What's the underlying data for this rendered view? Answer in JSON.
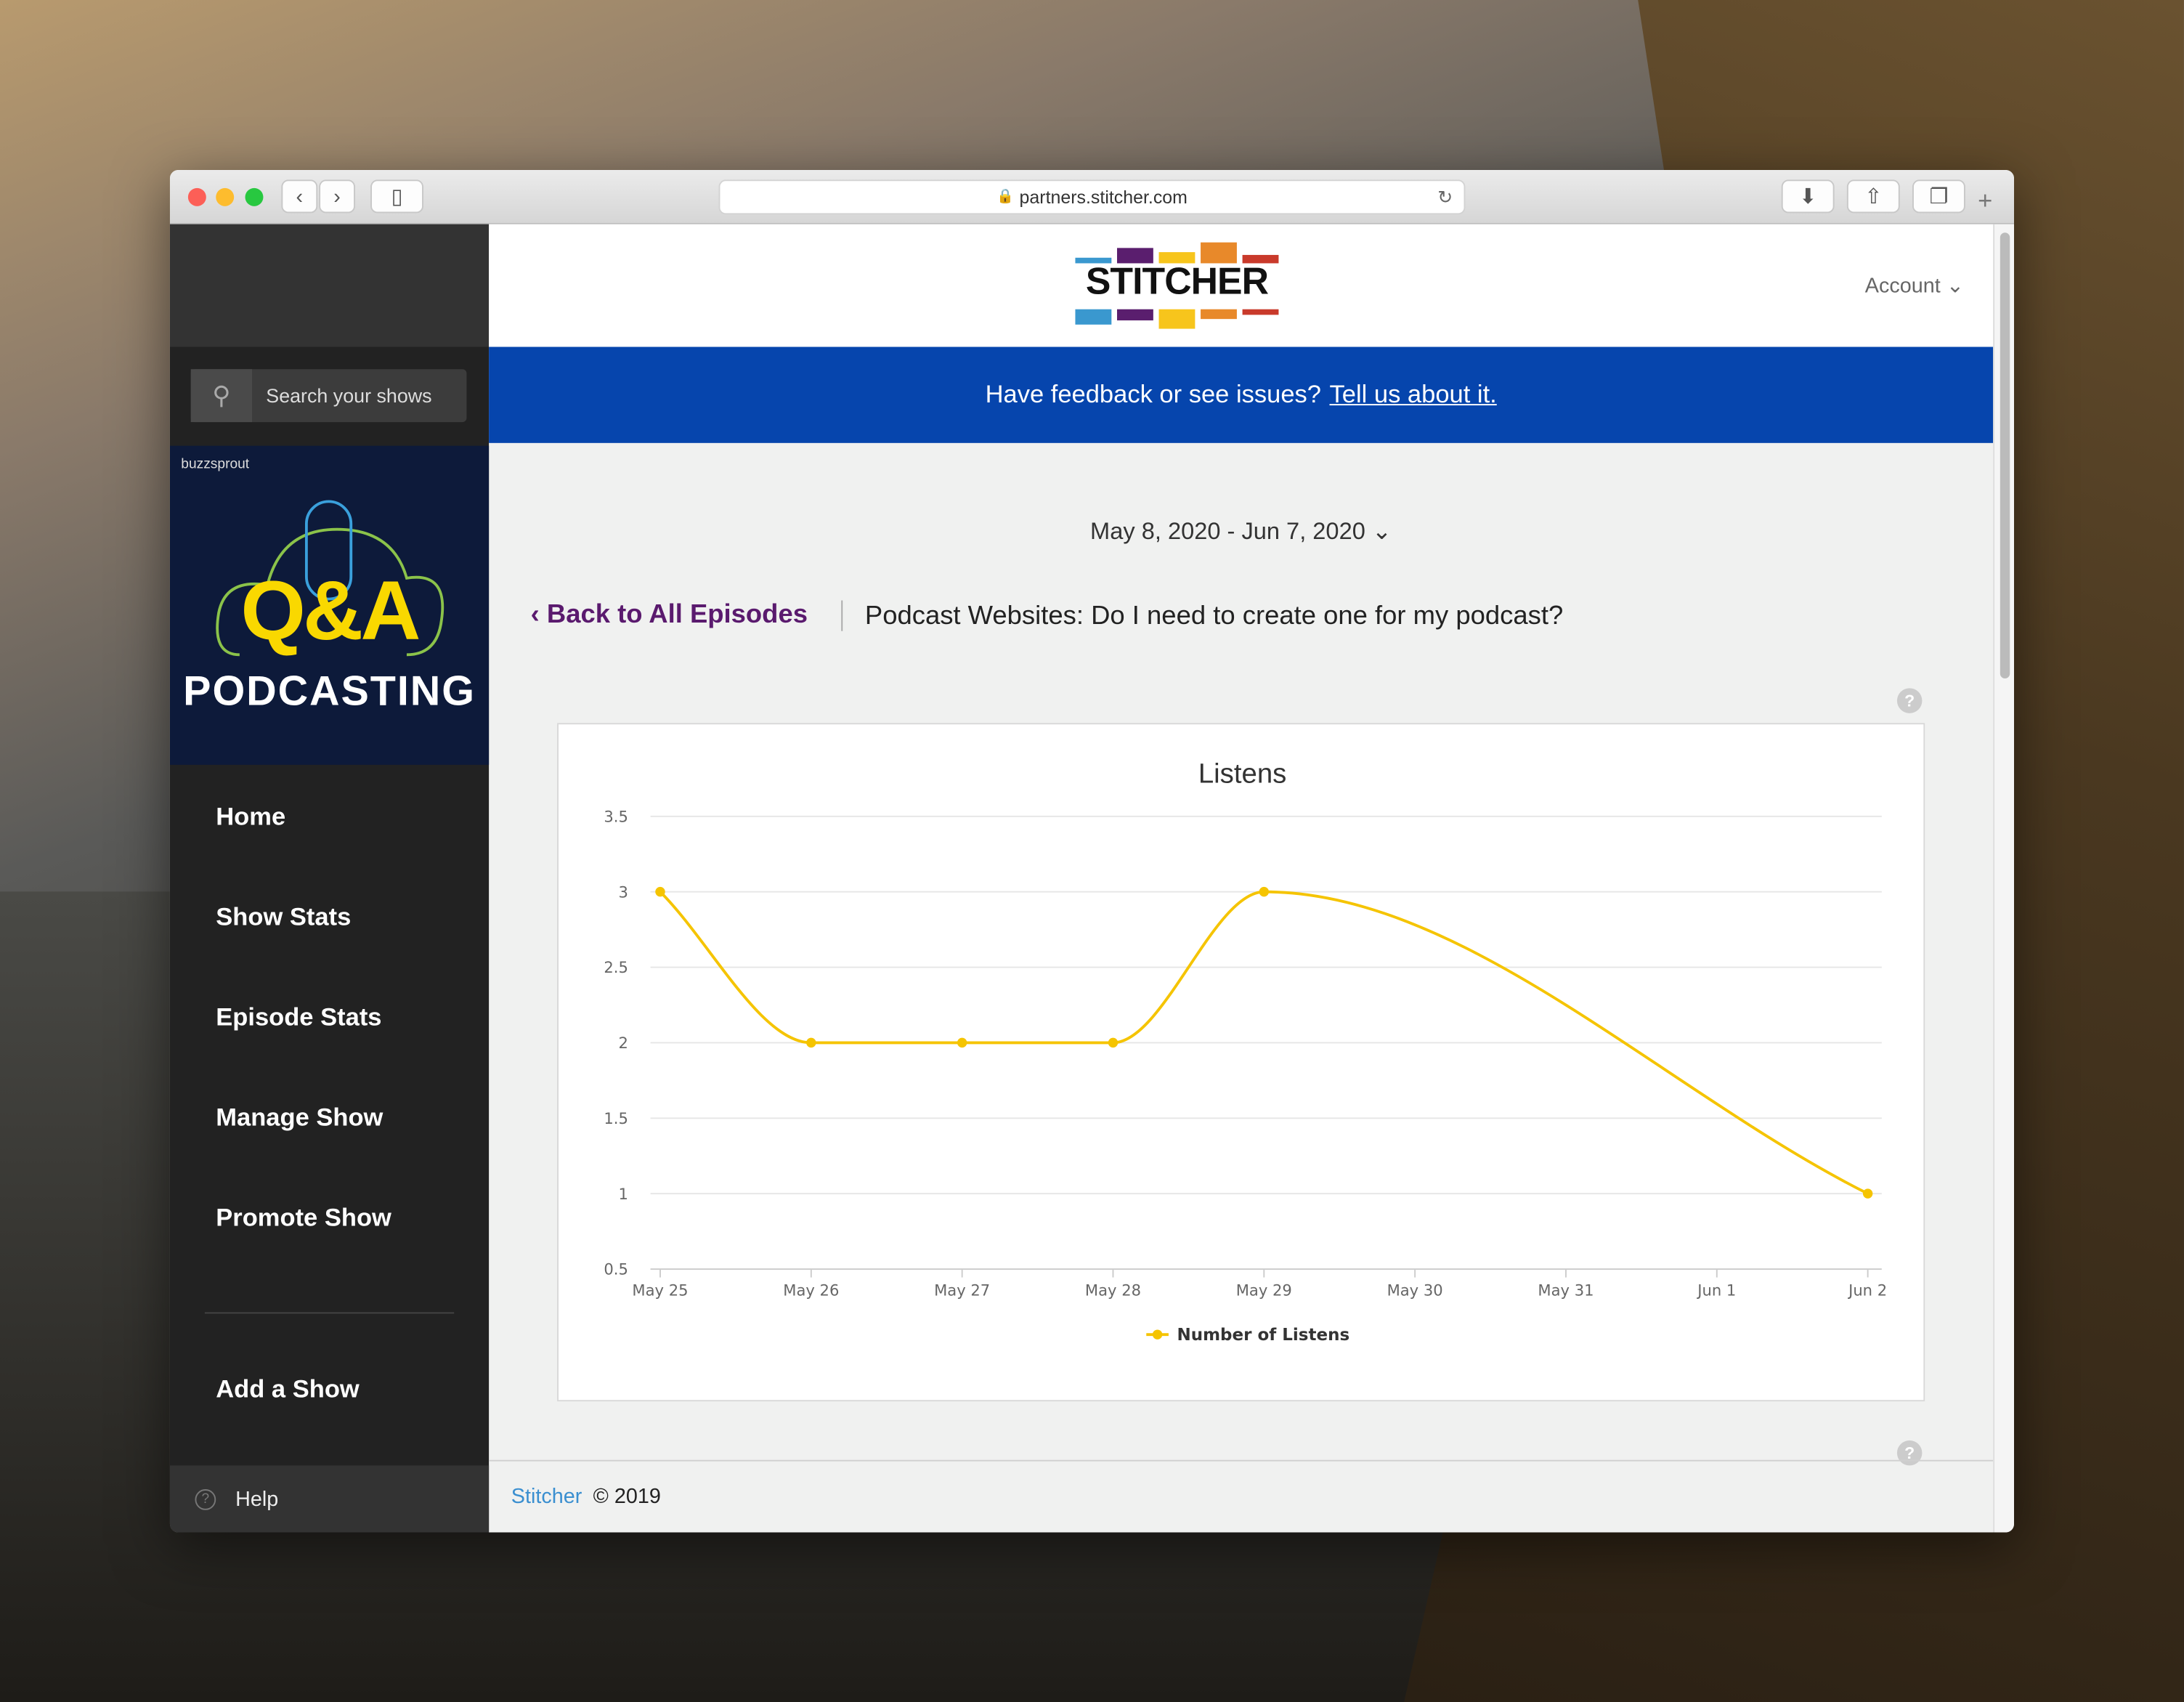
{
  "browser": {
    "url": "partners.stitcher.com"
  },
  "sidebar": {
    "search_placeholder": "Search your shows",
    "artwork": {
      "brand": "buzzsprout",
      "title_letters": "Q&A",
      "title": "PODCASTING"
    },
    "items": [
      {
        "label": "Home"
      },
      {
        "label": "Show Stats"
      },
      {
        "label": "Episode Stats"
      },
      {
        "label": "Manage Show"
      },
      {
        "label": "Promote Show"
      },
      {
        "label": "Add a Show"
      }
    ],
    "help": "Help"
  },
  "header": {
    "logo": "STITCHER",
    "account": "Account"
  },
  "banner": {
    "text": "Have feedback or see issues?",
    "link": "Tell us about it."
  },
  "date_range": "May 8, 2020 - Jun 7, 2020",
  "back_link": "Back to All Episodes",
  "episode_title": "Podcast Websites: Do I need to create one for my podcast?",
  "footer": {
    "brand": "Stitcher",
    "copyright": "© 2019"
  },
  "colors": {
    "accent": "#0645ad",
    "series": "#f5c400",
    "back_link": "#5a1a6e"
  },
  "chart_data": {
    "type": "line",
    "title": "Listens",
    "categories": [
      "May 25",
      "May 26",
      "May 27",
      "May 28",
      "May 29",
      "May 30",
      "May 31",
      "Jun 1",
      "Jun 2"
    ],
    "yticks": [
      "0.5",
      "1",
      "1.5",
      "2",
      "2.5",
      "3",
      "3.5"
    ],
    "ylim": [
      0.5,
      3.5
    ],
    "grid": true,
    "legend": "bottom",
    "series": [
      {
        "name": "Number of Listens",
        "values": [
          3,
          2,
          2,
          2,
          3,
          null,
          null,
          null,
          1
        ]
      }
    ]
  }
}
